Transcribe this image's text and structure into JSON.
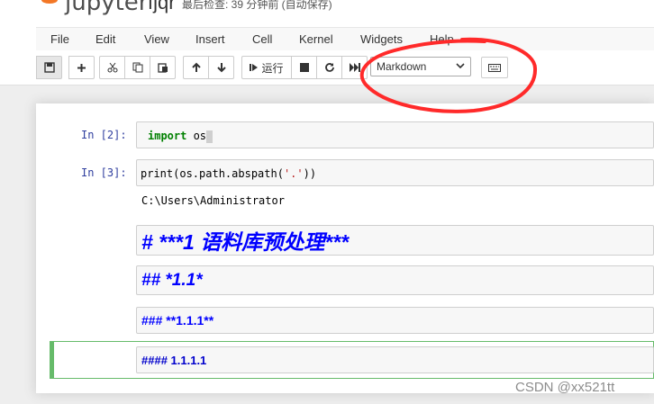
{
  "app": {
    "logo_text": "jupyter",
    "notebook_name": "fjqr",
    "save_status": "最后检查: 39 分钟前  (自动保存)"
  },
  "menu": [
    "File",
    "Edit",
    "View",
    "Insert",
    "Cell",
    "Kernel",
    "Widgets",
    "Help"
  ],
  "toolbar": {
    "run_label": "运行",
    "cell_type": "Markdown"
  },
  "cells": [
    {
      "prompt": "In  [2]:",
      "kw": "import",
      "rest": " os"
    },
    {
      "prompt": "In  [3]:",
      "code_pre": "print(os.path.abspath(",
      "code_str": "'.'",
      "code_post": "))",
      "output": "C:\\Users\\Administrator"
    }
  ],
  "markdown": {
    "h1": "# ***1 语料库预处理***",
    "h2": "## *1.1*",
    "h3": "### **1.1.1**",
    "h4": "#### 1.1.1.1"
  },
  "colors": {
    "accent": "#f37726",
    "prompt": "#303f9f",
    "markdown_heading": "#0000ff",
    "selected_border": "#66bb6a",
    "annotation": "#ff2a2a"
  },
  "watermark": "CSDN @xx521tt"
}
